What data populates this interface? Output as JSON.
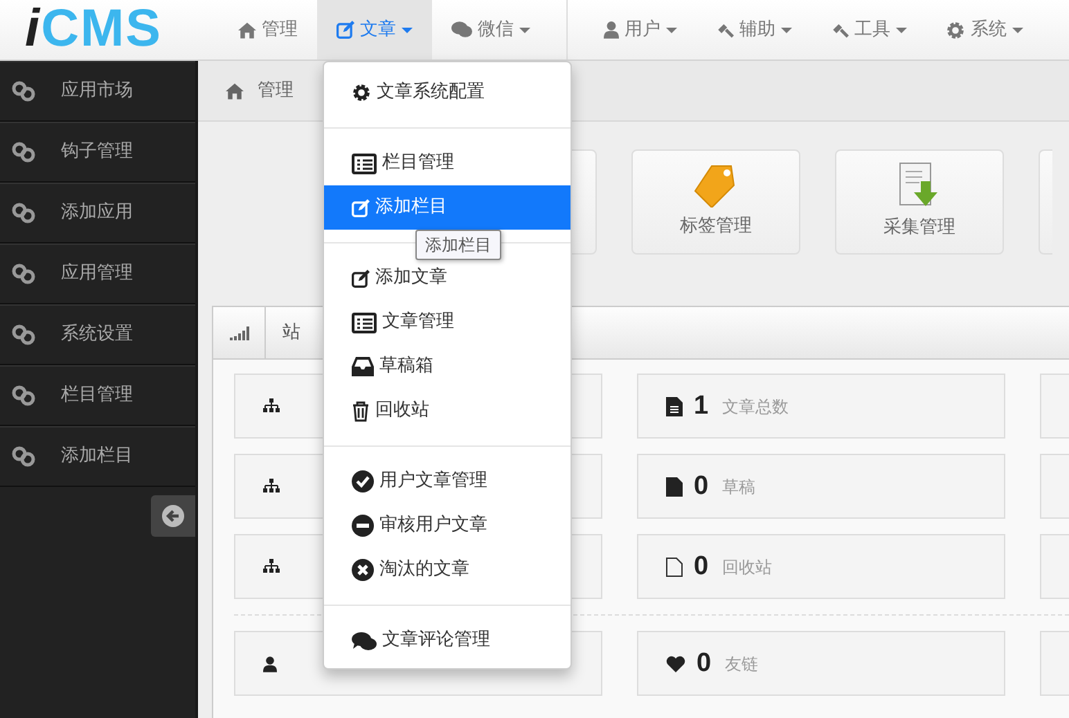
{
  "logo": {
    "prefix": "i",
    "text": "CMS"
  },
  "nav_groups": [
    [
      {
        "label": "管理",
        "caret": false,
        "selected": false
      },
      {
        "label": "文章",
        "caret": true,
        "selected": true
      },
      {
        "label": "微信",
        "caret": true,
        "selected": false
      }
    ],
    [
      {
        "label": "用户",
        "caret": true,
        "selected": false
      },
      {
        "label": "辅助",
        "caret": true,
        "selected": false
      },
      {
        "label": "工具",
        "caret": true,
        "selected": false
      },
      {
        "label": "系统",
        "caret": true,
        "selected": false
      }
    ]
  ],
  "sidebar": {
    "items": [
      {
        "label": "应用市场"
      },
      {
        "label": "钩子管理"
      },
      {
        "label": "添加应用"
      },
      {
        "label": "应用管理"
      },
      {
        "label": "系统设置"
      },
      {
        "label": "栏目管理"
      },
      {
        "label": "添加栏目"
      }
    ]
  },
  "breadcrumb": [
    "管理"
  ],
  "quick_buttons": [
    {
      "kind": "covered"
    },
    {
      "kind": "full",
      "label": "标签管理"
    },
    {
      "kind": "full",
      "label": "采集管理"
    },
    {
      "kind": "cut"
    }
  ],
  "panel": {
    "tab_title": "站"
  },
  "stat_groups": [
    [
      [
        {
          "kind": "covered"
        },
        {
          "kind": "full",
          "value": "1",
          "label": "文章总数"
        },
        {
          "kind": "cut"
        }
      ],
      [
        {
          "kind": "covered"
        },
        {
          "kind": "full",
          "value": "0",
          "label": "草稿"
        },
        {
          "kind": "cut"
        }
      ],
      [
        {
          "kind": "covered"
        },
        {
          "kind": "full",
          "value": "0",
          "label": "回收站"
        },
        {
          "kind": "cut"
        }
      ]
    ],
    [
      [
        {
          "kind": "covered"
        },
        {
          "kind": "full",
          "value": "0",
          "label": "友链"
        },
        {
          "kind": "cut"
        }
      ]
    ]
  ],
  "dropdown_menu": {
    "sections": [
      [
        {
          "label": "文章系统配置",
          "selected": false
        }
      ],
      [
        {
          "label": "栏目管理",
          "selected": false
        },
        {
          "label": "添加栏目",
          "selected": true
        }
      ],
      [
        {
          "label": "添加文章",
          "selected": false
        },
        {
          "label": "文章管理",
          "selected": false
        },
        {
          "label": "草稿箱",
          "selected": false
        },
        {
          "label": "回收站",
          "selected": false
        }
      ],
      [
        {
          "label": "用户文章管理",
          "selected": false
        },
        {
          "label": "审核用户文章",
          "selected": false
        },
        {
          "label": "淘汰的文章",
          "selected": false
        }
      ],
      [
        {
          "label": "文章评论管理",
          "selected": false
        }
      ]
    ]
  },
  "tooltip": {
    "text": "添加栏目"
  }
}
